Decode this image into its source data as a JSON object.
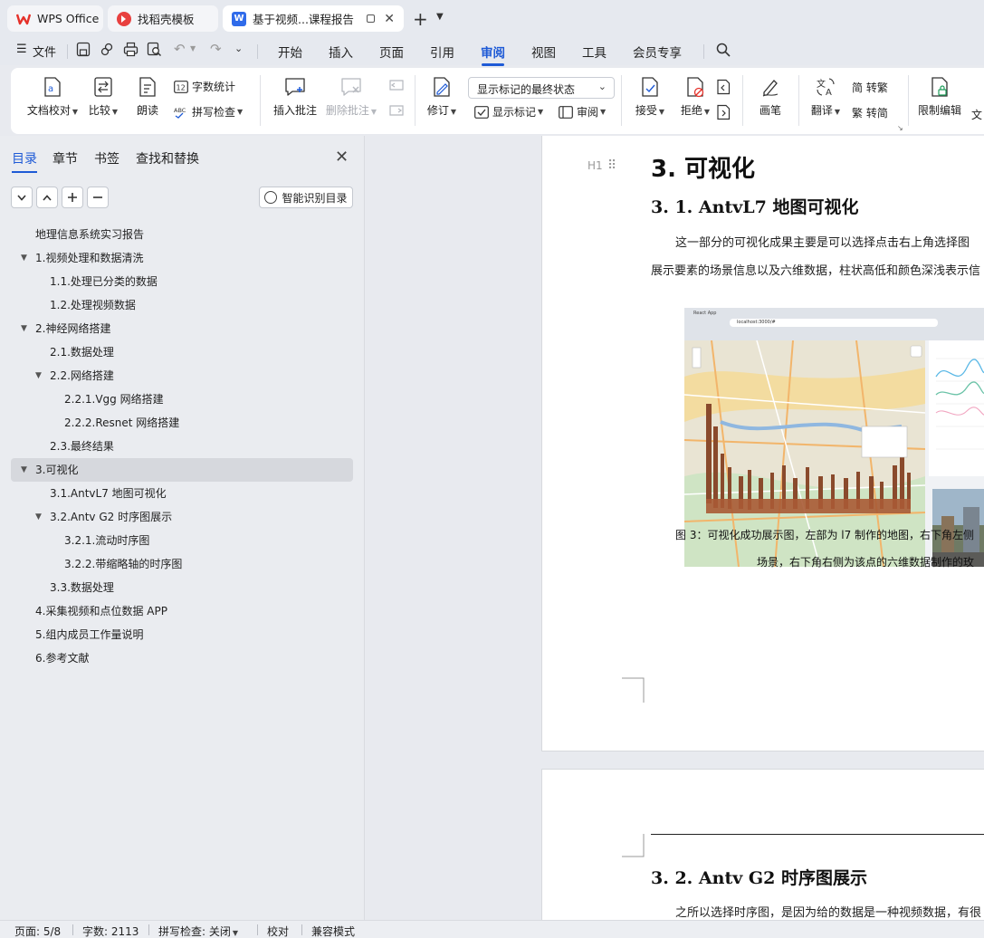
{
  "tabs": [
    {
      "label": "WPS Office",
      "icon": "wps-logo-icon",
      "color": "#e5312a"
    },
    {
      "label": "找稻壳模板",
      "icon": "docer-icon",
      "color": "#e8403f"
    },
    {
      "label": "基于视频...课程报告",
      "icon": "word-doc-icon",
      "color": "#2f6bea"
    }
  ],
  "menu": {
    "file": "文件",
    "items": [
      "开始",
      "插入",
      "页面",
      "引用",
      "审阅",
      "视图",
      "工具",
      "会员专享"
    ],
    "active": "审阅"
  },
  "ribbon": {
    "doc_check": "文档校对",
    "compare": "比较",
    "read_aloud": "朗读",
    "word_count": "字数统计",
    "spell_check": "拼写检查",
    "insert_comment": "插入批注",
    "delete_comment": "删除批注",
    "track_changes": "修订",
    "markup_state": "显示标记的最终状态",
    "show_markup": "显示标记",
    "review_pane": "审阅",
    "accept": "接受",
    "reject": "拒绝",
    "pen": "画笔",
    "translate": "翻译",
    "to_traditional": "简 转繁",
    "to_simplified": "繁 转简",
    "restrict_edit": "限制编辑",
    "doc_permission_partial": "文"
  },
  "nav": {
    "tabs": [
      "目录",
      "章节",
      "书签",
      "查找和替换"
    ],
    "active_tab": "目录",
    "smart_toc": "智能识别目录",
    "toc": [
      {
        "label": "地理信息系统实习报告",
        "level": 0,
        "arrow": false,
        "selected": false
      },
      {
        "label": "1.视频处理和数据清洗",
        "level": 0,
        "arrow": true,
        "selected": false
      },
      {
        "label": "1.1.处理已分类的数据",
        "level": 1,
        "arrow": false,
        "selected": false
      },
      {
        "label": "1.2.处理视频数据",
        "level": 1,
        "arrow": false,
        "selected": false
      },
      {
        "label": "2.神经网络搭建",
        "level": 0,
        "arrow": true,
        "selected": false
      },
      {
        "label": "2.1.数据处理",
        "level": 1,
        "arrow": false,
        "selected": false
      },
      {
        "label": "2.2.网络搭建",
        "level": 1,
        "arrow": true,
        "selected": false
      },
      {
        "label": "2.2.1.Vgg 网络搭建",
        "level": 2,
        "arrow": false,
        "selected": false
      },
      {
        "label": "2.2.2.Resnet 网络搭建",
        "level": 2,
        "arrow": false,
        "selected": false
      },
      {
        "label": "2.3.最终结果",
        "level": 1,
        "arrow": false,
        "selected": false
      },
      {
        "label": "3.可视化",
        "level": 0,
        "arrow": true,
        "selected": true
      },
      {
        "label": "3.1.AntvL7 地图可视化",
        "level": 1,
        "arrow": false,
        "selected": false
      },
      {
        "label": "3.2.Antv G2 时序图展示",
        "level": 1,
        "arrow": true,
        "selected": false
      },
      {
        "label": "3.2.1.流动时序图",
        "level": 2,
        "arrow": false,
        "selected": false
      },
      {
        "label": "3.2.2.带缩略轴的时序图",
        "level": 2,
        "arrow": false,
        "selected": false
      },
      {
        "label": "3.3.数据处理",
        "level": 1,
        "arrow": false,
        "selected": false
      },
      {
        "label": "4.采集视频和点位数据 APP",
        "level": 0,
        "arrow": false,
        "selected": false
      },
      {
        "label": "5.组内成员工作量说明",
        "level": 0,
        "arrow": false,
        "selected": false
      },
      {
        "label": "6.参考文献",
        "level": 0,
        "arrow": false,
        "selected": false
      }
    ]
  },
  "document": {
    "heading_marker": "H1",
    "h1": "3.    可视化",
    "h2_1": "3. 1.   AntvL7 地图可视化",
    "para1_line1": "这一部分的可视化成果主要是可以选择点击右上角选择图",
    "para1_line2": "展示要素的场景信息以及六维数据，柱状高低和颜色深浅表示信",
    "figure": {
      "browser_title": "React App",
      "url": "localhost:3000/#"
    },
    "caption_line1": "图 3：可视化成功展示图，左部为 l7 制作的地图，右下角左侧",
    "caption_line2": "场景，右下角右侧为该点的六维数据制作的玫",
    "h2_2": "3. 2.   Antv G2 时序图展示",
    "para2": "之所以选择时序图，是因为给的数据是一种视频数据，有很"
  },
  "status": {
    "page": "页面: 5/8",
    "word_count": "字数: 2113",
    "spell_check": "拼写检查: 关闭",
    "proofread": "校对",
    "compat_mode": "兼容模式"
  },
  "colors": {
    "accent": "#1e5ad6"
  }
}
